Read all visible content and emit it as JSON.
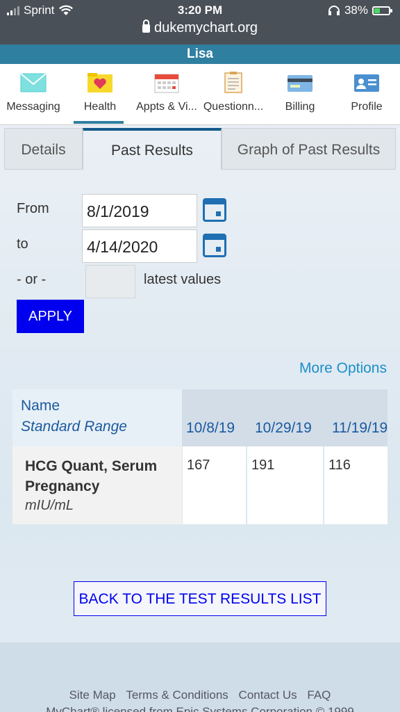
{
  "status": {
    "carrier": "Sprint",
    "time": "3:20 PM",
    "battery": "38%",
    "url": "dukemychart.org"
  },
  "user": {
    "name": "Lisa"
  },
  "nav": [
    {
      "label": "Messaging"
    },
    {
      "label": "Health"
    },
    {
      "label": "Appts & Vi..."
    },
    {
      "label": "Questionn..."
    },
    {
      "label": "Billing"
    },
    {
      "label": "Profile"
    }
  ],
  "tabs": [
    {
      "label": "Details"
    },
    {
      "label": "Past Results"
    },
    {
      "label": "Graph of Past Results"
    }
  ],
  "form": {
    "from_label": "From",
    "from_value": "8/1/2019",
    "to_label": "to",
    "to_value": "4/14/2020",
    "or_label": "- or -",
    "latest_label": "latest values",
    "apply": "APPLY",
    "more_options": "More Options"
  },
  "table": {
    "header_name": "Name",
    "header_range": "Standard Range",
    "dates": [
      "10/8/19",
      "10/29/19",
      "11/19/19"
    ],
    "row": {
      "name": "HCG Quant, Serum Pregnancy",
      "unit": "mIU/mL",
      "values": [
        "167",
        "191",
        "116"
      ]
    }
  },
  "back_button": "BACK TO THE TEST RESULTS LIST",
  "footer": {
    "links": [
      "Site Map",
      "Terms & Conditions",
      "Contact Us",
      "FAQ"
    ],
    "copyright": "MyChart® licensed from Epic Systems Corporation © 1999"
  }
}
